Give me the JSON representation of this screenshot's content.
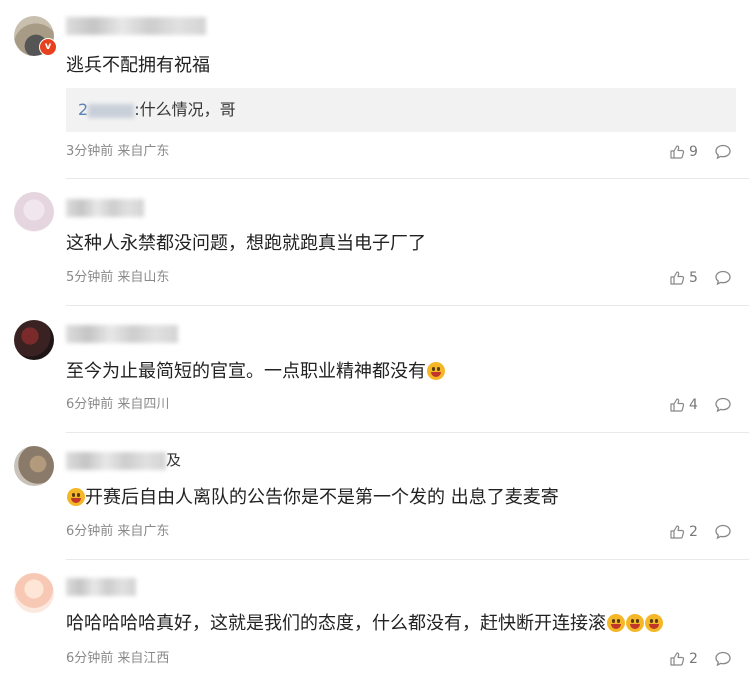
{
  "comments": [
    {
      "name_visible": "",
      "text": "逃兵不配拥有祝福",
      "reply": {
        "name_visible": "2",
        "text": ":什么情况，哥"
      },
      "meta": "3分钟前 来自广东",
      "likes": "9",
      "verified_badge": "v"
    },
    {
      "name_visible": "",
      "text": "这种人永禁都没问题，想跑就跑真当电子厂了",
      "meta": "5分钟前 来自山东",
      "likes": "5"
    },
    {
      "name_visible": "",
      "text": "至今为止最简短的官宣。一点职业精神都没有",
      "meta": "6分钟前 来自四川",
      "likes": "4"
    },
    {
      "name_visible": "及",
      "text": "开赛后自由人离队的公告你是不是第一个发的 出息了麦麦寄",
      "meta": "6分钟前 来自广东",
      "likes": "2"
    },
    {
      "name_visible": "",
      "text": "哈哈哈哈哈真好，这就是我们的态度，什么都没有，赶快断开连接滚",
      "meta": "6分钟前 来自江西",
      "likes": "2"
    }
  ],
  "colors": {
    "accent": "#5c7fb4",
    "badge": "#e8411e",
    "emoji": "#f4b728"
  },
  "icons": [
    "thumb-up-icon",
    "comment-icon",
    "verified-badge-icon",
    "laughing-emoji-icon"
  ]
}
